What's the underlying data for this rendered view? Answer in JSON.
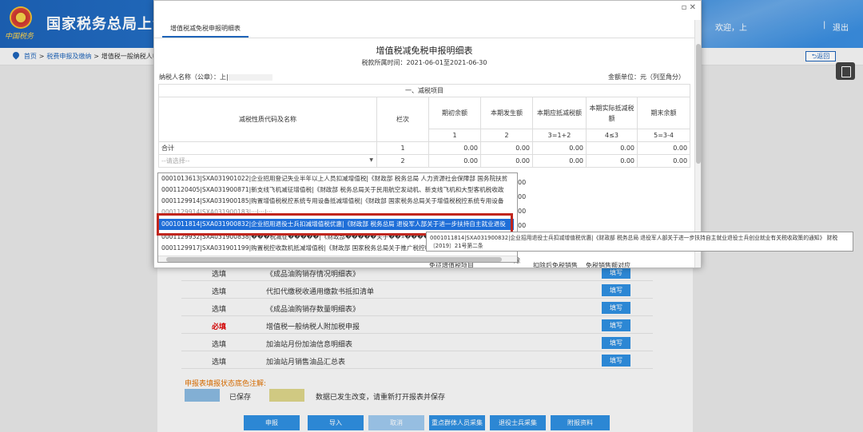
{
  "header": {
    "title": "国家税务总局上海",
    "emblem_caption": "中国税务",
    "welcome": "欢迎，上",
    "separator": "|",
    "exit": "退出"
  },
  "breadcrumb": {
    "home": "首页",
    "sep1": ">",
    "item1": "税费申报及缴纳",
    "sep2": ">",
    "item2": "增值税一般纳税人申"
  },
  "back_button": "返回",
  "modal": {
    "tab": "增值税减免税申报明细表",
    "title": "增值税减免税申报明细表",
    "period": "税款所属时间：2021-06-01至2021-06-30",
    "taxpayer_label": "纳税人名称（公章）：上|",
    "amount_unit": "金额单位：元（列至角分）",
    "section": "一、减税项目",
    "headers": {
      "code": "减税性质代码及名称",
      "row": "栏次",
      "c1": "期初余额",
      "c2": "本期发生额",
      "c3": "本期应抵减税额",
      "c4": "本期实际抵减税额",
      "c5": "期末余额"
    },
    "subheaders": {
      "c1": "1",
      "c2": "2",
      "c3": "3=1+2",
      "c4": "4≤3",
      "c5": "5=3-4"
    },
    "rows": [
      {
        "name": "合计",
        "row": "1",
        "v": [
          "0.00",
          "0.00",
          "0.00",
          "0.00",
          "0.00"
        ]
      },
      {
        "name": "--请选择--",
        "row": "2",
        "v": [
          "0.00",
          "0.00",
          "0.00",
          "0.00",
          "0.00"
        ]
      }
    ],
    "partial_values": [
      "00",
      "00",
      "00",
      "00",
      "00"
    ],
    "under_labels": [
      "免征增值税项目",
      "扣除后免税销售",
      "免税销售额对应"
    ],
    "under_partial": "除"
  },
  "dropdown": {
    "options": [
      "0001013613|SXA031901022|企业招用登记失业半年以上人员扣减增值税|《财政部 税务总局 人力资源社会保障部 国务院扶贫",
      "0001120405|SXA031900871|新支线飞机减征增值税|《财政部 税务总局关于民用航空发动机、新支线飞机和大型客机税收政",
      "0001129914|SXA031900185|购置增值税税控系统专用设备抵减增值税|《财政部 国家税务总局关于增值税税控系统专用设备",
      "0001011814|SXA031900832|企业招用退役士兵扣减增值税优惠|《财政部 税务总局 退役军人部关于进一步扶持自主就业退役",
      "0001129932|SXA031900838|���税减征�����|《财政部�����关于��»��������税收��",
      "0001129917|SXA031901199|购置税控收款机抵减增值税|《财政部 国家税务总局关于推广税控收款机有关税收政策的通知"
    ],
    "selected_index": 3,
    "tooltip": "0001011814|SXA031900832|企业招用退役士兵扣减增值税优惠|《财政部 税务总局 退役军人部关于进一步扶持自主就业退役士兵创业就业有关税收政策的通知》 财税〔2019〕21号第二条"
  },
  "content_rows": [
    {
      "req": "选填",
      "name": "《成品油购销存情况明细表》",
      "fill": "填写",
      "required": false
    },
    {
      "req": "选填",
      "name": "代扣代缴税收通用缴款书抵扣清单",
      "fill": "填写",
      "required": false
    },
    {
      "req": "选填",
      "name": "《成品油购销存数量明细表》",
      "fill": "填写",
      "required": false
    },
    {
      "req": "必填",
      "name": "增值税一般纳税人附加税申报",
      "fill": "填写",
      "required": true
    },
    {
      "req": "选填",
      "name": "加油站月份加油信息明细表",
      "fill": "填写",
      "required": false
    },
    {
      "req": "选填",
      "name": "加油站月销售油品汇总表",
      "fill": "填写",
      "required": false
    }
  ],
  "legend": {
    "title": "申报表填报状态底色注解:",
    "saved": "已保存",
    "changed": "数据已发生改变，请重新打开报表并保存",
    "saved_color": "#8ab9e0",
    "changed_color": "#dcd48a"
  },
  "actions": [
    "申报",
    "导入",
    "取消",
    "重点群体人员采集",
    "退役士兵采集",
    "附报资料"
  ]
}
